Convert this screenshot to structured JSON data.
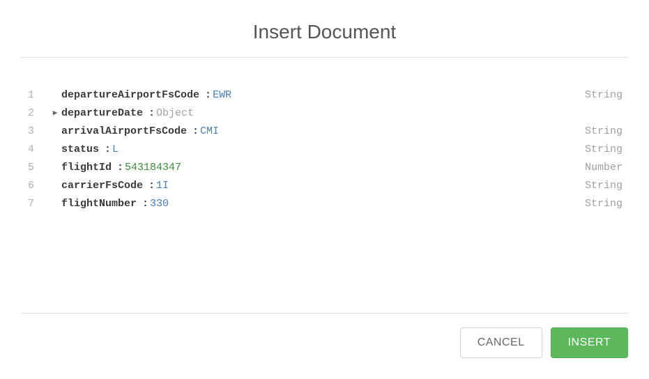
{
  "dialog": {
    "title": "Insert Document"
  },
  "fields": [
    {
      "line": "1",
      "expandable": false,
      "key": "departureAirportFsCode",
      "value": "EWR",
      "valueClass": "value-string",
      "type": "String"
    },
    {
      "line": "2",
      "expandable": true,
      "key": "departureDate",
      "value": "Object",
      "valueClass": "value-object",
      "type": ""
    },
    {
      "line": "3",
      "expandable": false,
      "key": "arrivalAirportFsCode",
      "value": "CMI",
      "valueClass": "value-string",
      "type": "String"
    },
    {
      "line": "4",
      "expandable": false,
      "key": "status",
      "value": "L",
      "valueClass": "value-string",
      "type": "String"
    },
    {
      "line": "5",
      "expandable": false,
      "key": "flightId",
      "value": "543184347",
      "valueClass": "value-number",
      "type": "Number"
    },
    {
      "line": "6",
      "expandable": false,
      "key": "carrierFsCode",
      "value": "1I",
      "valueClass": "value-string",
      "type": "String"
    },
    {
      "line": "7",
      "expandable": false,
      "key": "flightNumber",
      "value": "330",
      "valueClass": "value-string",
      "type": "String"
    }
  ],
  "buttons": {
    "cancel": "CANCEL",
    "insert": "INSERT"
  }
}
